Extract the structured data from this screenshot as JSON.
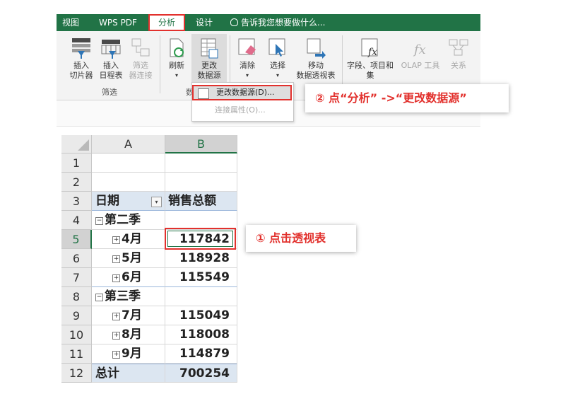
{
  "ribbon": {
    "tabs": {
      "view": "视图",
      "wps_pdf": "WPS PDF",
      "analyze": "分析",
      "design": "设计",
      "tell_me": "告诉我您想要做什么..."
    },
    "buttons": {
      "insert_slicer_1": "插入",
      "insert_slicer_2": "切片器",
      "insert_timeline_1": "插入",
      "insert_timeline_2": "日程表",
      "filter_conn_1": "筛选",
      "filter_conn_2": "器连接",
      "refresh": "刷新",
      "change_source_1": "更改",
      "change_source_2": "数据源",
      "clear": "清除",
      "select": "选择",
      "move_pivot_1": "移动",
      "move_pivot_2": "数据透视表",
      "fields_items_1": "字段、项目和",
      "fields_items_2": "集",
      "olap_tools": "OLAP 工具",
      "relationships": "关系"
    },
    "groups": {
      "filter": "筛选",
      "data_partial": "数"
    },
    "dropdown": {
      "change_source": "更改数据源(D)...",
      "connection_props": "连接属性(O)..."
    }
  },
  "callouts": {
    "step2": "② 点“分析” ->“更改数据源”",
    "step1": "① 点击透视表"
  },
  "sheet": {
    "columns": [
      "A",
      "B"
    ],
    "rows": [
      {
        "n": "1",
        "a": "",
        "b": ""
      },
      {
        "n": "2",
        "a": "",
        "b": ""
      },
      {
        "n": "3",
        "a": "日期",
        "b": "销售总额"
      },
      {
        "n": "4",
        "a": "第二季",
        "b": ""
      },
      {
        "n": "5",
        "a": "4月",
        "b": "117842"
      },
      {
        "n": "6",
        "a": "5月",
        "b": "118928"
      },
      {
        "n": "7",
        "a": "6月",
        "b": "115549"
      },
      {
        "n": "8",
        "a": "第三季",
        "b": ""
      },
      {
        "n": "9",
        "a": "7月",
        "b": "115049"
      },
      {
        "n": "10",
        "a": "8月",
        "b": "118008"
      },
      {
        "n": "11",
        "a": "9月",
        "b": "114879"
      },
      {
        "n": "12",
        "a": "总计",
        "b": "700254"
      }
    ],
    "expand_symbols": {
      "collapse": "−",
      "expand": "+",
      "filter": "▾"
    }
  },
  "colors": {
    "ribbon_green": "#217346",
    "highlight_red": "#e2312d",
    "pivot_header": "#dce6f1"
  }
}
